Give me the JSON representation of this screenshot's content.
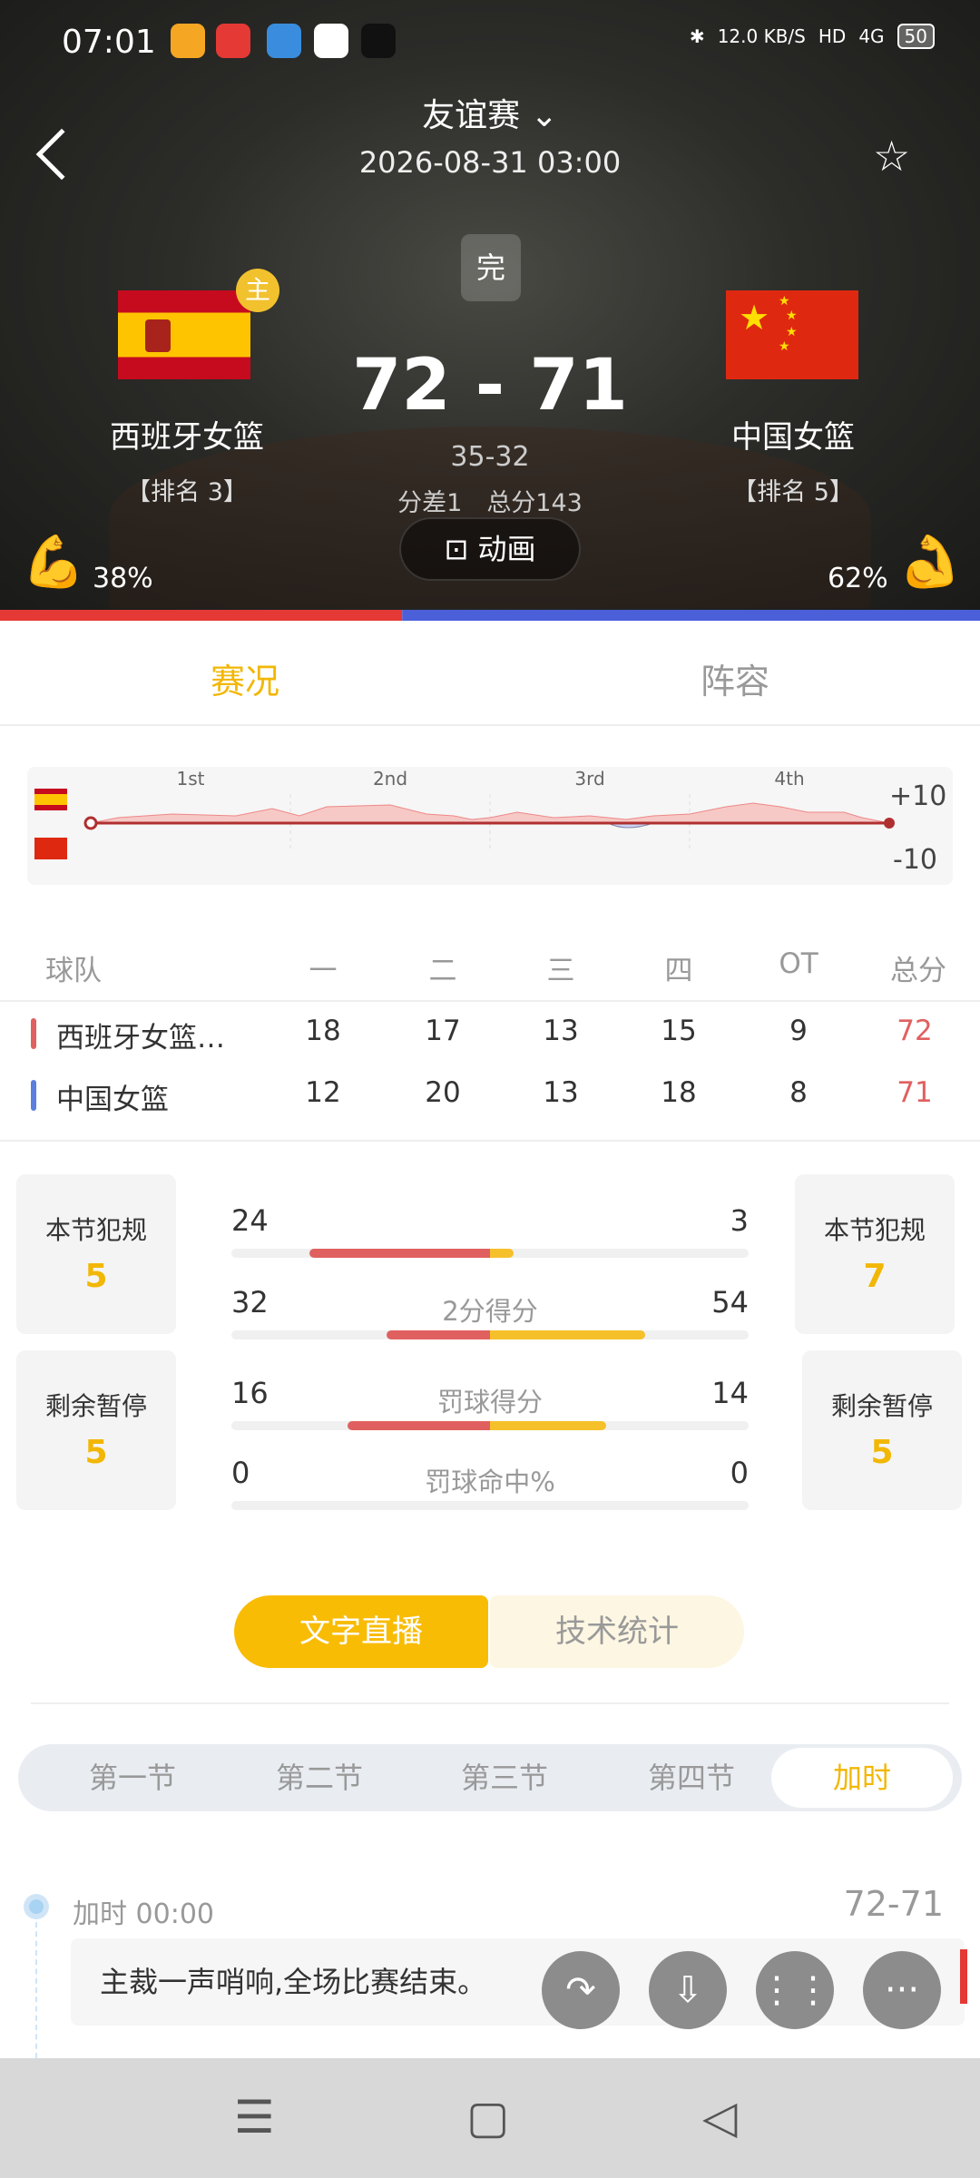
{
  "status_bar": {
    "time": "07:01",
    "net_speed": "12.0",
    "net_unit": "KB/S",
    "hd": "HD",
    "signal": "4G",
    "battery": "50"
  },
  "header": {
    "title": "友谊赛",
    "date": "2026-08-31 03:00",
    "status": "完",
    "home_badge": "主",
    "score": "72 - 71",
    "half_score": "35-32",
    "diff": "分差1",
    "total": "总分143",
    "anim_label": "动画",
    "home": {
      "name": "西班牙女篮",
      "rank": "【排名 3】",
      "pct": "38%"
    },
    "away": {
      "name": "中国女篮",
      "rank": "【排名 5】",
      "pct": "62%"
    }
  },
  "tabs": [
    "赛况",
    "阵容"
  ],
  "trend_chart": {
    "quarters": [
      "1st",
      "2nd",
      "3rd",
      "4th"
    ],
    "ymax": "+10",
    "ymin": "-10"
  },
  "chart_data": {
    "type": "area",
    "title": "",
    "x": [
      "1st",
      "2nd",
      "3rd",
      "4th"
    ],
    "ylim": [
      -10,
      10
    ],
    "y_tick_labels": [
      "+10",
      "-10"
    ]
  },
  "quarter_table": {
    "headers": [
      "球队",
      "一",
      "二",
      "三",
      "四",
      "OT",
      "总分"
    ],
    "rows": [
      {
        "team": "西班牙女篮…",
        "q": [
          "18",
          "17",
          "13",
          "15",
          "9"
        ],
        "total": "72",
        "color": "#e06060"
      },
      {
        "team": "中国女篮",
        "q": [
          "12",
          "20",
          "13",
          "18",
          "8"
        ],
        "total": "71",
        "color": "#5a7fe0"
      }
    ]
  },
  "fouls": {
    "label": "本节犯规",
    "home": "5",
    "away": "7"
  },
  "timeouts": {
    "label": "剩余暂停",
    "home": "5",
    "away": "5"
  },
  "stats": [
    {
      "label": "",
      "home": "24",
      "away": "3",
      "home_ratio": 0.7,
      "away_ratio": 0.09
    },
    {
      "label": "2分得分",
      "home": "32",
      "away": "54",
      "home_ratio": 0.4,
      "away_ratio": 0.6
    },
    {
      "label": "罚球得分",
      "home": "16",
      "away": "14",
      "home_ratio": 0.55,
      "away_ratio": 0.45
    },
    {
      "label": "罚球命中%",
      "home": "0",
      "away": "0",
      "home_ratio": 0,
      "away_ratio": 0
    }
  ],
  "live_tabs": [
    "文字直播",
    "技术统计"
  ],
  "period_tabs": [
    "第一节",
    "第二节",
    "第三节",
    "第四节",
    "加时"
  ],
  "event": {
    "time": "加时 00:00",
    "score": "72-71",
    "text": "主裁一声哨响,全场比赛结束。"
  },
  "colors": {
    "accent": "#f8bc05",
    "home": "#e06060",
    "away": "#5a7fe0"
  }
}
